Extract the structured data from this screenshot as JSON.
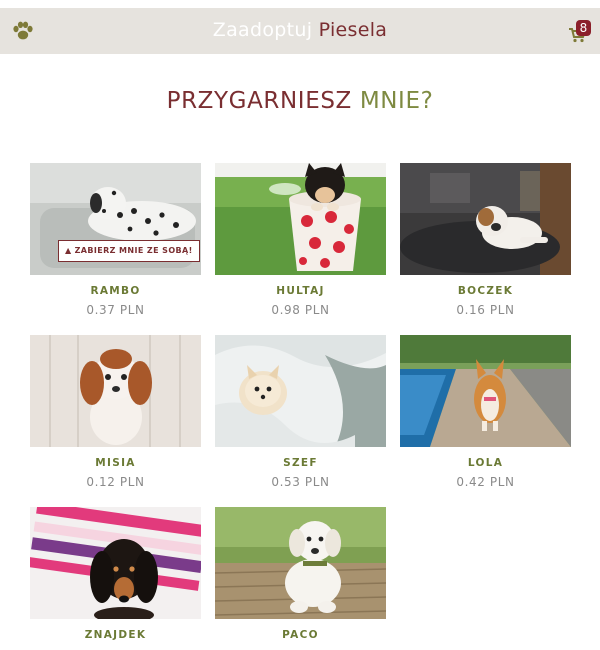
{
  "header": {
    "brand_part1": "Zaadoptuj",
    "brand_part2": "Piesela",
    "cart_count": "8",
    "colors": {
      "bar": "#e6e3de",
      "accent": "#7a2e31",
      "olive": "#7e8a41"
    }
  },
  "main": {
    "title_part1": "PRZYGARNIESZ",
    "title_part2": "MNIE?",
    "adopt_button_label": "ZABIERZ MNIE ZE SOBĄ!",
    "dogs": [
      {
        "name": "RAMBO",
        "price": "0.37 PLN"
      },
      {
        "name": "HULTAJ",
        "price": "0.98 PLN"
      },
      {
        "name": "BOCZEK",
        "price": "0.16 PLN"
      },
      {
        "name": "MISIA",
        "price": "0.12 PLN"
      },
      {
        "name": "SZEF",
        "price": "0.53 PLN"
      },
      {
        "name": "LOLA",
        "price": "0.42 PLN"
      },
      {
        "name": "ZNAJDEK",
        "price": ""
      },
      {
        "name": "PACO",
        "price": ""
      }
    ]
  }
}
